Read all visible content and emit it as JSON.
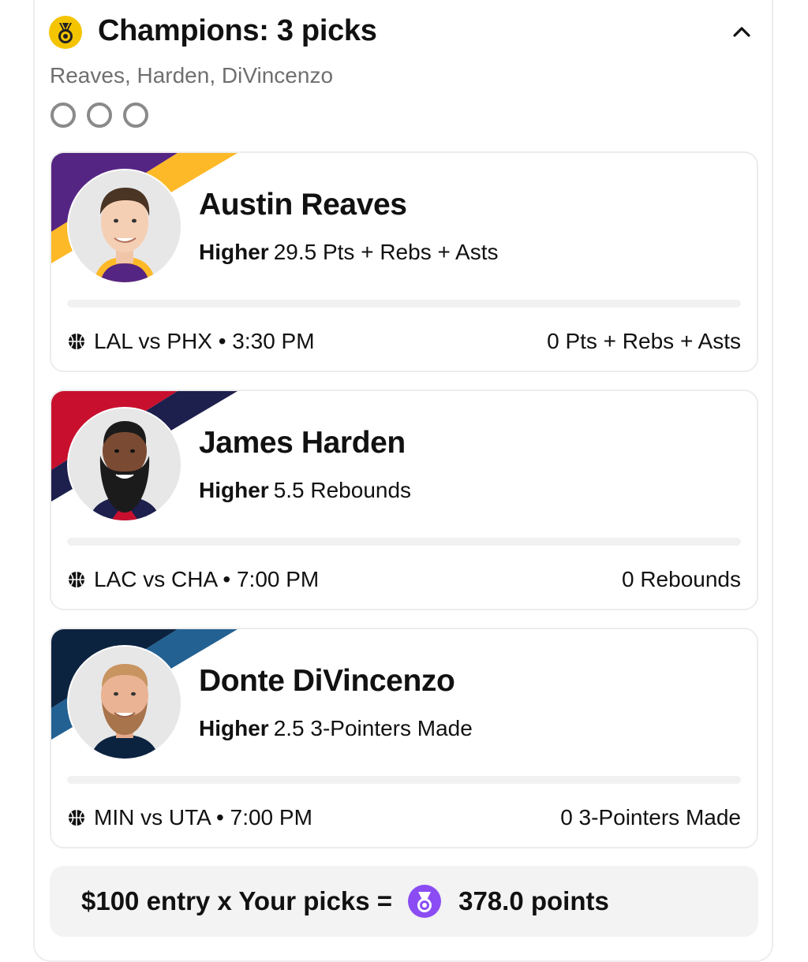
{
  "header": {
    "title": "Champions: 3 picks",
    "players_summary": "Reaves, Harden, DiVincenzo",
    "status_circles": 3,
    "icon": "medal-icon",
    "collapse_icon": "chevron-up-icon",
    "badge_color": "#f5c400"
  },
  "picks": [
    {
      "name": "Austin Reaves",
      "direction": "Higher",
      "line": "29.5 Pts + Rebs + Asts",
      "game": "LAL vs PHX • 3:30 PM",
      "current": "0 Pts + Rebs + Asts",
      "progress": 0,
      "team_colors": [
        "#552583",
        "#fdb927"
      ]
    },
    {
      "name": "James Harden",
      "direction": "Higher",
      "line": "5.5 Rebounds",
      "game": "LAC vs CHA • 7:00 PM",
      "current": "0 Rebounds",
      "progress": 0,
      "team_colors": [
        "#c8102e",
        "#1d1f4d"
      ]
    },
    {
      "name": "Donte DiVincenzo",
      "direction": "Higher",
      "line": "2.5 3-Pointers Made",
      "game": "MIN vs UTA • 7:00 PM",
      "current": "0 3-Pointers Made",
      "progress": 0,
      "team_colors": [
        "#0c2340",
        "#236192"
      ]
    }
  ],
  "summary": {
    "text": "$100 entry x Your picks =",
    "points": "378.0 points",
    "icon": "points-medal-icon",
    "icon_color": "#8b4cf3"
  }
}
